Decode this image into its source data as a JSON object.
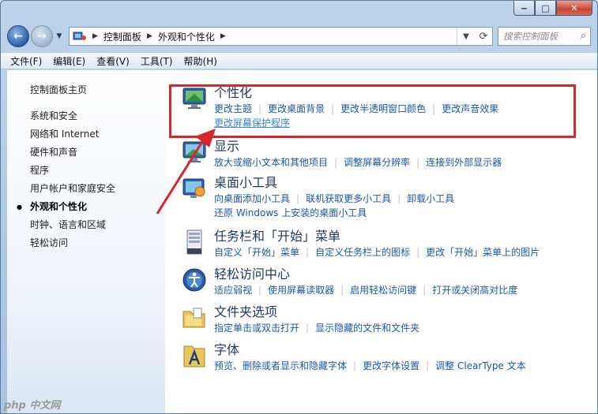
{
  "window": {
    "caption": {
      "minimize_glyph": "‒",
      "maximize_glyph": "□",
      "close_glyph": "✕"
    }
  },
  "address_bar": {
    "back_glyph": "←",
    "forward_glyph": "→",
    "crumbs": [
      "控制面板",
      "外观和个性化"
    ],
    "search_placeholder": "搜索控制面板",
    "search_icon": "magnifier-icon"
  },
  "menubar": {
    "items": [
      "文件(F)",
      "编辑(E)",
      "查看(V)",
      "工具(T)",
      "帮助(H)"
    ]
  },
  "leftpane": {
    "home": "控制面板主页",
    "items": [
      "系统和安全",
      "网络和 Internet",
      "硬件和声音",
      "程序",
      "用户帐户和家庭安全",
      "外观和个性化",
      "时钟、语言和区域",
      "轻松访问"
    ],
    "active": "外观和个性化"
  },
  "sections": [
    {
      "title": "个性化",
      "icon": "personalization-icon",
      "lines": [
        [
          "更改主题",
          "更改桌面背景",
          "更改半透明窗口颜色",
          "更改声音效果"
        ],
        [
          "更改屏幕保护程序"
        ]
      ]
    },
    {
      "title": "显示",
      "icon": "display-icon",
      "lines": [
        [
          "放大或缩小文本和其他项目",
          "调整屏幕分辨率",
          "连接到外部显示器"
        ]
      ]
    },
    {
      "title": "桌面小工具",
      "icon": "gadgets-icon",
      "lines": [
        [
          "向桌面添加小工具",
          "联机获取更多小工具",
          "卸载小工具"
        ],
        [
          "还原 Windows 上安装的桌面小工具"
        ]
      ]
    },
    {
      "title": "任务栏和「开始」菜单",
      "icon": "taskbar-icon",
      "lines": [
        [
          "自定义「开始」菜单",
          "自定义任务栏上的图标",
          "更改「开始」菜单上的图片"
        ]
      ]
    },
    {
      "title": "轻松访问中心",
      "icon": "ease-of-access-icon",
      "lines": [
        [
          "适应弱视",
          "使用屏幕读取器",
          "启用轻松访问键",
          "打开或关闭高对比度"
        ]
      ]
    },
    {
      "title": "文件夹选项",
      "icon": "folder-options-icon",
      "lines": [
        [
          "指定单击或双击打开",
          "显示隐藏的文件和文件夹"
        ]
      ]
    },
    {
      "title": "字体",
      "icon": "fonts-icon",
      "lines": [
        [
          "预览、删除或者显示和隐藏字体",
          "更改字体设置",
          "调整 ClearType 文本"
        ]
      ]
    }
  ],
  "annotation": {
    "box_color": "#d8262b"
  },
  "watermark": "php 中文网"
}
